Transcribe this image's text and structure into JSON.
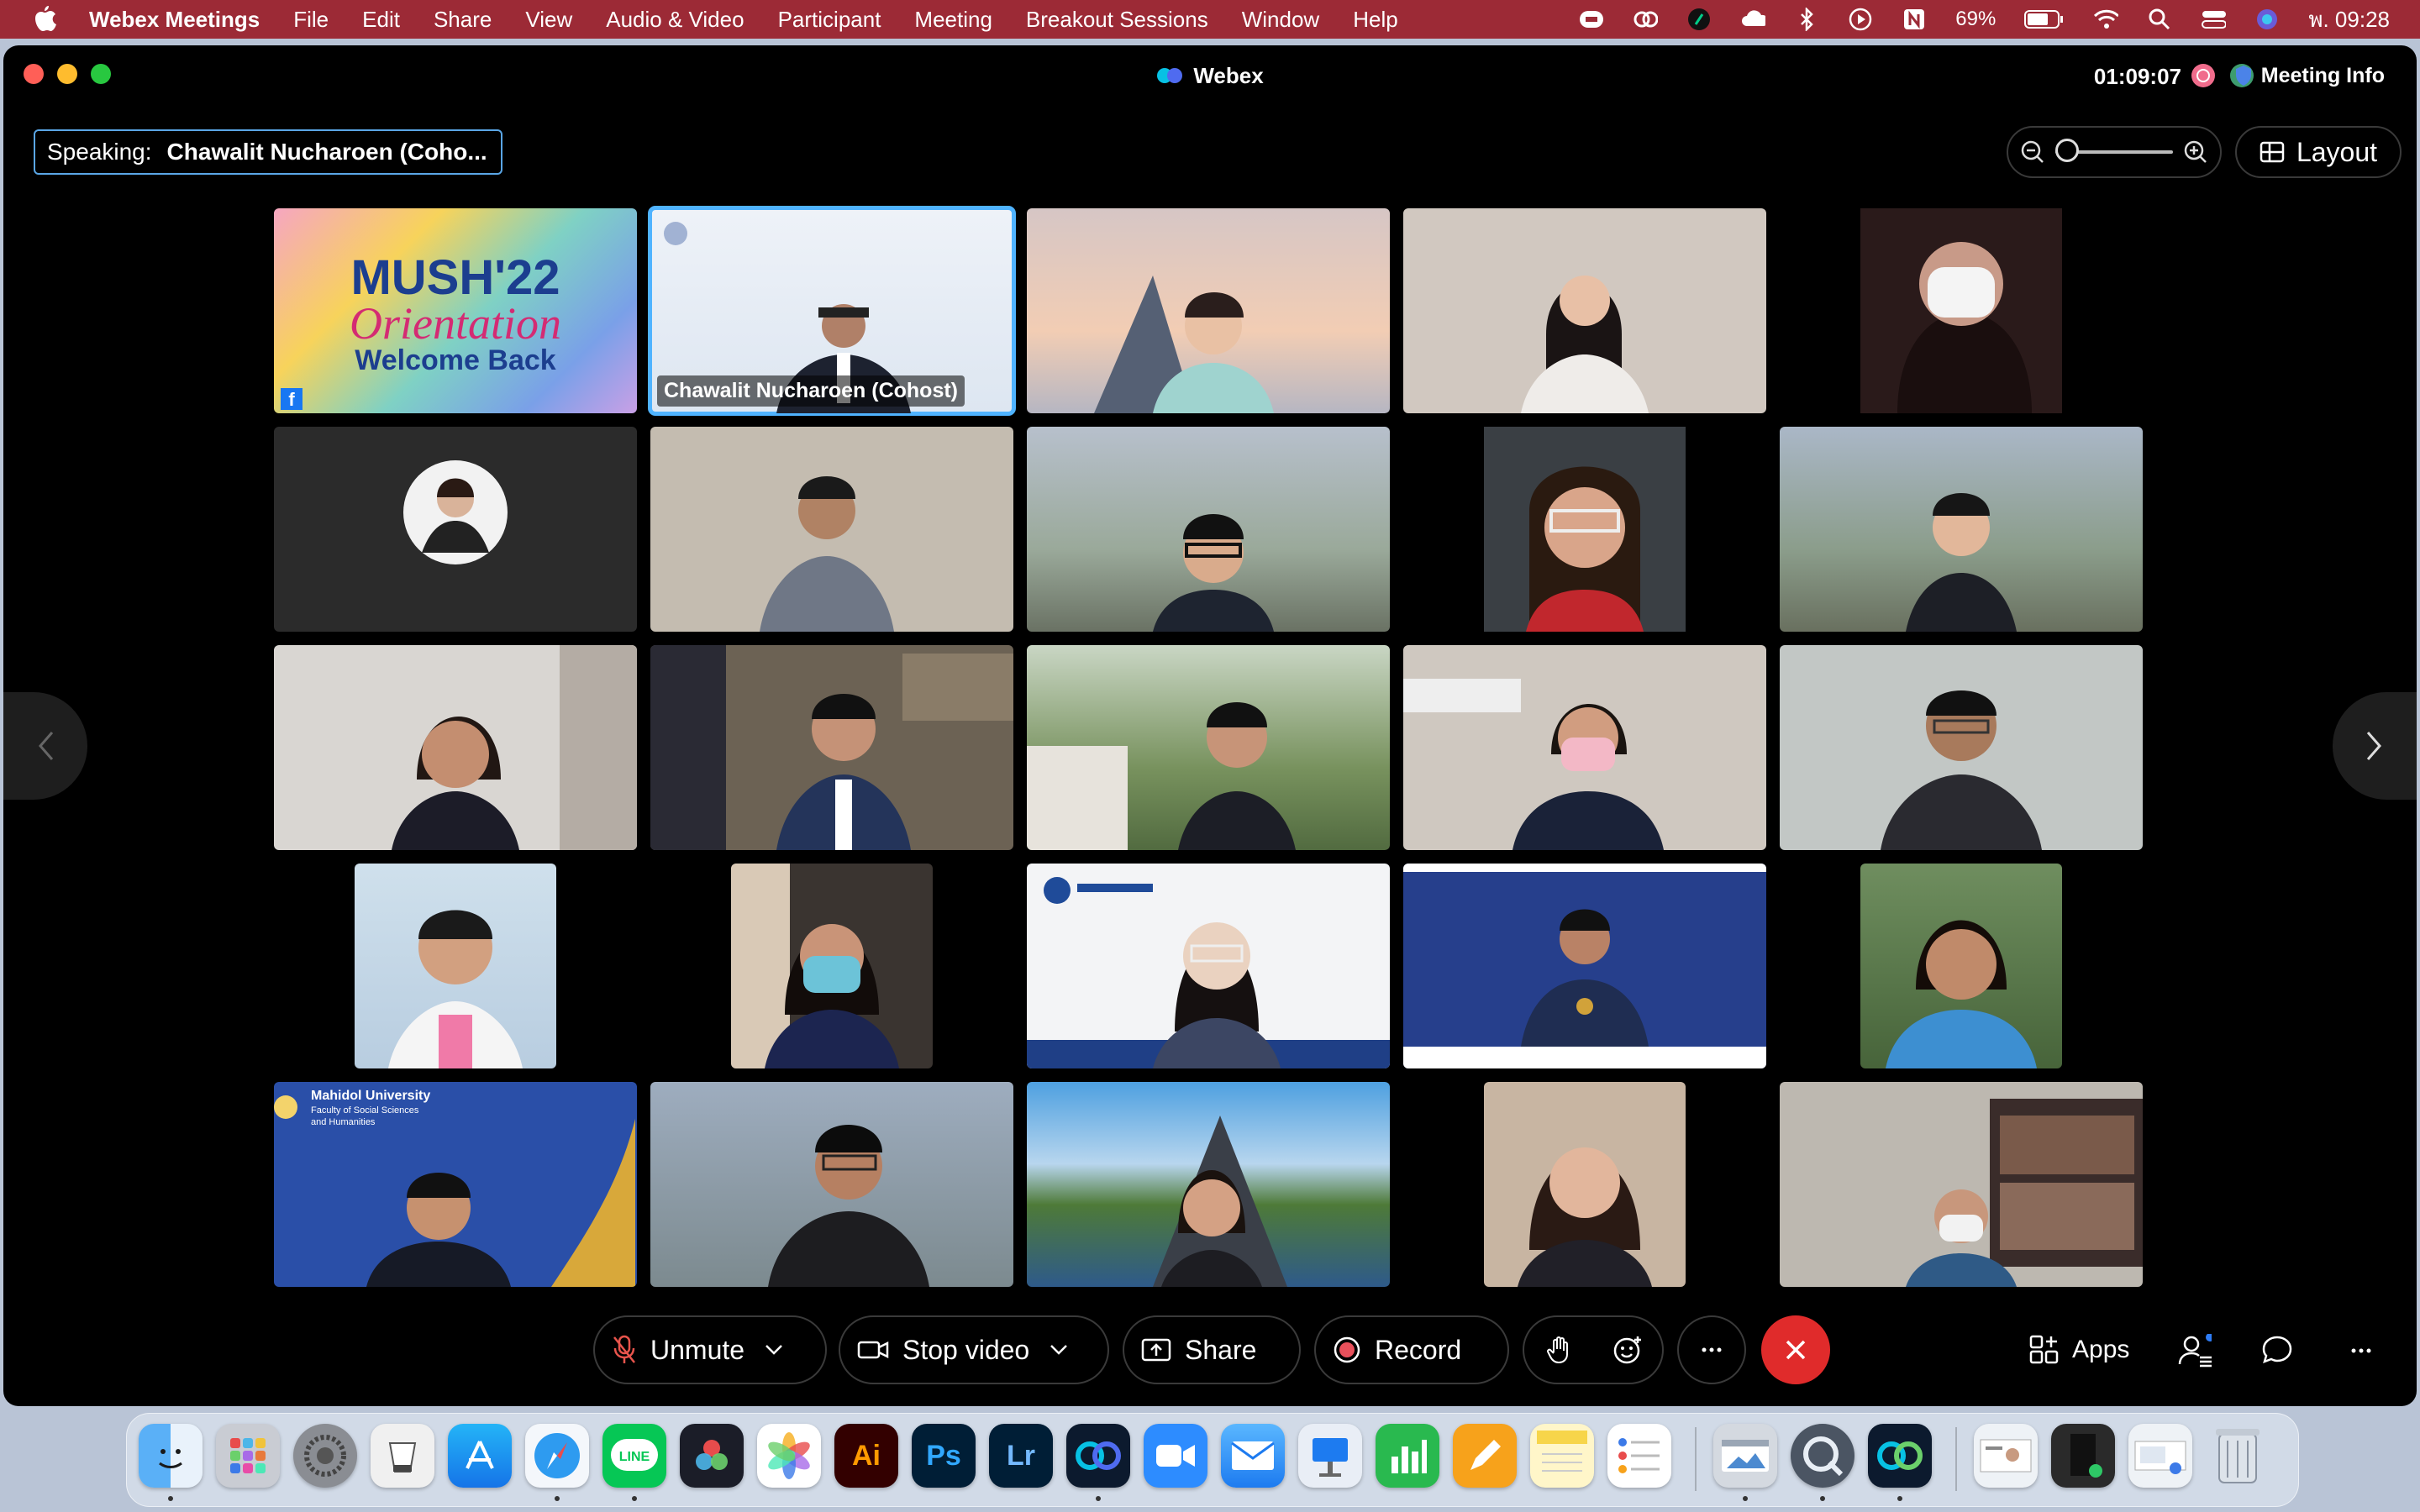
{
  "menubar": {
    "app_name": "Webex Meetings",
    "items": [
      "File",
      "Edit",
      "Share",
      "View",
      "Audio & Video",
      "Participant",
      "Meeting",
      "Breakout Sessions",
      "Window",
      "Help"
    ],
    "battery_percent": "69%",
    "clock": "พ. 09:28"
  },
  "window": {
    "title": "Webex",
    "timer": "01:09:07",
    "meeting_info_label": "Meeting Info"
  },
  "speaking": {
    "label": "Speaking:",
    "name": "Chawalit Nucharoen (Coho..."
  },
  "layout_label": "Layout",
  "tiles": [
    {
      "nameplate": "",
      "content": "MUSH'22 Orientation Welcome Back"
    },
    {
      "nameplate": "Chawalit Nucharoen  (Cohost)",
      "active": true
    },
    {
      "nameplate": ""
    },
    {
      "nameplate": ""
    },
    {
      "nameplate": ""
    },
    {
      "nameplate": ""
    },
    {
      "nameplate": ""
    },
    {
      "nameplate": ""
    },
    {
      "nameplate": ""
    },
    {
      "nameplate": ""
    },
    {
      "nameplate": ""
    },
    {
      "nameplate": ""
    },
    {
      "nameplate": ""
    },
    {
      "nameplate": ""
    },
    {
      "nameplate": ""
    },
    {
      "nameplate": ""
    },
    {
      "nameplate": ""
    },
    {
      "nameplate": ""
    },
    {
      "nameplate": ""
    },
    {
      "nameplate": ""
    },
    {
      "nameplate": "",
      "content": "Mahidol University Faculty of Social Sciences and Humanities"
    },
    {
      "nameplate": ""
    },
    {
      "nameplate": ""
    },
    {
      "nameplate": ""
    },
    {
      "nameplate": ""
    }
  ],
  "banner": {
    "line1": "MUSH'22",
    "line2": "Orientation",
    "line3": "Welcome Back",
    "mahidol_1": "Mahidol University",
    "mahidol_2": "Faculty of Social Sciences",
    "mahidol_3": "and Humanities"
  },
  "controls": {
    "unmute": "Unmute",
    "stop_video": "Stop video",
    "share": "Share",
    "record": "Record",
    "apps": "Apps"
  },
  "colors": {
    "menubar_bg": "#9c2a36",
    "active_border": "#4fb3ff",
    "end_call": "#e02b2b"
  },
  "dock": {
    "icons": [
      "finder-icon",
      "launchpad-icon",
      "system-settings-icon",
      "preview-icon",
      "app-store-icon",
      "safari-icon",
      "line-icon",
      "davinci-icon",
      "photos-icon",
      "illustrator-icon",
      "photoshop-icon",
      "lightroom-icon",
      "webex-icon",
      "zoom-icon",
      "mail-icon",
      "keynote-icon",
      "numbers-icon",
      "pages-icon",
      "notes-icon",
      "reminders-icon",
      "preview-window-icon",
      "quicktime-icon",
      "webex-meetings-icon",
      "thumb-1",
      "thumb-2",
      "thumb-3",
      "trash-icon"
    ],
    "ai_label": "Ai",
    "ps_label": "Ps",
    "lr_label": "Lr",
    "line_label": "LINE"
  }
}
